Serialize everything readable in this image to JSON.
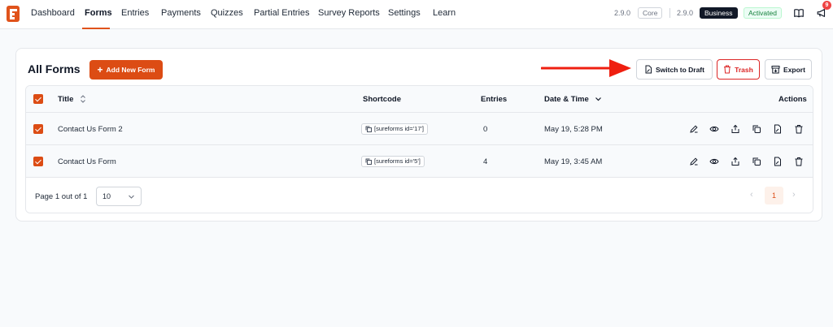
{
  "nav": {
    "items": [
      "Dashboard",
      "Forms",
      "Entries",
      "Payments",
      "Quizzes",
      "Partial Entries",
      "Survey Reports",
      "Settings",
      "Learn"
    ],
    "core_version": "2.9.0",
    "core_label": "Core",
    "business_version": "2.9.0",
    "business_label": "Business",
    "activated_label": "Activated",
    "notification_count": "9"
  },
  "page": {
    "title": "All Forms",
    "add_button": "Add New Form",
    "switch_draft": "Switch to Draft",
    "trash": "Trash",
    "export": "Export"
  },
  "table": {
    "headers": {
      "title": "Title",
      "shortcode": "Shortcode",
      "entries": "Entries",
      "datetime": "Date & Time",
      "actions": "Actions"
    },
    "rows": [
      {
        "title": "Contact Us Form 2",
        "shortcode": "[sureforms id='17']",
        "entries": "0",
        "date": "May 19, 5:28 PM"
      },
      {
        "title": "Contact Us Form",
        "shortcode": "[sureforms id='5']",
        "entries": "4",
        "date": "May 19, 3:45 AM"
      }
    ]
  },
  "pagination": {
    "page_text": "Page 1 out of 1",
    "per_page": "10",
    "current": "1"
  },
  "colors": {
    "brand": "#dc4c14",
    "arrow": "#ef1f10"
  },
  "icons": {
    "row_actions": [
      "pencil-icon",
      "eye-icon",
      "share-icon",
      "duplicate-icon",
      "draft-icon",
      "trash-icon"
    ]
  }
}
